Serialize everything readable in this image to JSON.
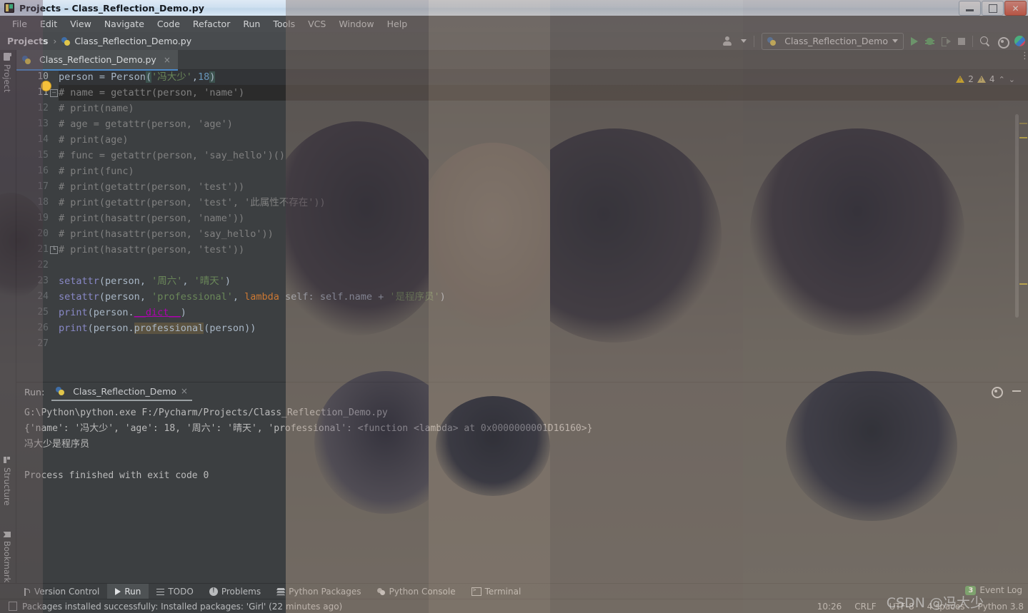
{
  "window": {
    "title": "Projects – Class_Reflection_Demo.py",
    "app_icon": "pycharm-logo-icon",
    "controls": [
      {
        "name": "minimize-button",
        "glyph": "minimize-icon"
      },
      {
        "name": "maximize-button",
        "glyph": "maximize-icon"
      },
      {
        "name": "close-button",
        "glyph": "close-icon",
        "color": "#d8432c"
      }
    ]
  },
  "menubar": {
    "items": [
      "File",
      "Edit",
      "View",
      "Navigate",
      "Code",
      "Refactor",
      "Run",
      "Tools",
      "VCS",
      "Window",
      "Help"
    ]
  },
  "navbar": {
    "crumbs": [
      "Projects",
      "Class_Reflection_Demo.py"
    ],
    "separator": "›",
    "file_icon": "python-file-icon",
    "account_icon": "account-icon",
    "run_config": {
      "name": "Class_Reflection_Demo",
      "icon": "python-file-icon",
      "dropdown_icon": "chevron-down-icon"
    },
    "actions": [
      {
        "name": "run-button",
        "icon": "run-triangle-icon"
      },
      {
        "name": "debug-button",
        "icon": "debug-bug-icon"
      },
      {
        "name": "run-with-coverage-button",
        "icon": "run-coverage-icon"
      },
      {
        "name": "stop-button",
        "icon": "stop-square-icon"
      },
      {
        "name": "search-everywhere-button",
        "icon": "search-icon"
      },
      {
        "name": "settings-button",
        "icon": "gear-icon"
      },
      {
        "name": "ide-logo",
        "icon": "intellij-logo-icon"
      }
    ]
  },
  "left_stripe": {
    "items": [
      {
        "label": "Project",
        "icon": "folder-icon"
      },
      {
        "label": "Structure",
        "icon": "structure-icon"
      },
      {
        "label": "Bookmarks",
        "icon": "bookmark-icon"
      }
    ]
  },
  "tabs": [
    {
      "label": "Class_Reflection_Demo.py",
      "icon": "python-file-icon",
      "close": "×",
      "active": true
    }
  ],
  "editor": {
    "first_line": 10,
    "kebab_glyph": "⋮",
    "inspections": {
      "warnings_major": "2",
      "warnings_minor": "4",
      "up": "⌃",
      "down": "⌄"
    },
    "lines": [
      {
        "n": 10,
        "state": "current",
        "tokens": [
          {
            "t": "person ",
            "c": "t-def"
          },
          {
            "t": "= ",
            "c": "t-def"
          },
          {
            "t": "Person",
            "c": "t-def"
          },
          {
            "t": "(",
            "c": "hl-brace t-def"
          },
          {
            "t": "'冯大少'",
            "c": "t-str"
          },
          {
            "t": ",",
            "c": "t-def"
          },
          {
            "t": "18",
            "c": "t-num"
          },
          {
            "t": ")",
            "c": "hl-brace t-def"
          }
        ]
      },
      {
        "n": 11,
        "state": "caret",
        "fold": true,
        "bulb": true,
        "tokens": [
          {
            "t": "# name = getattr(person, 'name')",
            "c": "t-cmt"
          }
        ]
      },
      {
        "n": 12,
        "tokens": [
          {
            "t": "# print(name)",
            "c": "t-cmt"
          }
        ]
      },
      {
        "n": 13,
        "tokens": [
          {
            "t": "# age = getattr(person, 'age')",
            "c": "t-cmt"
          }
        ]
      },
      {
        "n": 14,
        "tokens": [
          {
            "t": "# print(age)",
            "c": "t-cmt"
          }
        ]
      },
      {
        "n": 15,
        "tokens": [
          {
            "t": "# func = getattr(person, 'say_hello')()",
            "c": "t-cmt"
          }
        ]
      },
      {
        "n": 16,
        "tokens": [
          {
            "t": "# print(func)",
            "c": "t-cmt"
          }
        ]
      },
      {
        "n": 17,
        "tokens": [
          {
            "t": "# print(getattr(person, 'test'))",
            "c": "t-cmt"
          }
        ]
      },
      {
        "n": 18,
        "tokens": [
          {
            "t": "# print(getattr(person, 'test', '此属性不存在'))",
            "c": "t-cmt"
          }
        ]
      },
      {
        "n": 19,
        "tokens": [
          {
            "t": "# print(hasattr(person, 'name'))",
            "c": "t-cmt"
          }
        ]
      },
      {
        "n": 20,
        "tokens": [
          {
            "t": "# print(hasattr(person, 'say_hello'))",
            "c": "t-cmt"
          }
        ]
      },
      {
        "n": 21,
        "foldEnd": true,
        "tokens": [
          {
            "t": "# print(hasattr(person, 'test'))",
            "c": "t-cmt"
          }
        ]
      },
      {
        "n": 22,
        "tokens": []
      },
      {
        "n": 23,
        "tokens": [
          {
            "t": "setattr",
            "c": "t-builtin"
          },
          {
            "t": "(person",
            "c": "t-def"
          },
          {
            "t": ", ",
            "c": "t-def"
          },
          {
            "t": "'周六'",
            "c": "t-str"
          },
          {
            "t": ", ",
            "c": "t-def"
          },
          {
            "t": "'晴天'",
            "c": "t-str"
          },
          {
            "t": ")",
            "c": "t-def"
          }
        ]
      },
      {
        "n": 24,
        "tokens": [
          {
            "t": "setattr",
            "c": "t-builtin"
          },
          {
            "t": "(person",
            "c": "t-def"
          },
          {
            "t": ", ",
            "c": "t-def"
          },
          {
            "t": "'professional'",
            "c": "t-str"
          },
          {
            "t": ", ",
            "c": "t-def"
          },
          {
            "t": "lambda",
            "c": "t-kw"
          },
          {
            "t": " self: self.name + ",
            "c": "t-def"
          },
          {
            "t": "'是程序员'",
            "c": "t-str"
          },
          {
            "t": ")",
            "c": "t-def"
          }
        ]
      },
      {
        "n": 25,
        "tokens": [
          {
            "t": "print",
            "c": "t-builtin"
          },
          {
            "t": "(person.",
            "c": "t-def"
          },
          {
            "t": "__dict__",
            "c": "t-dunder"
          },
          {
            "t": ")",
            "c": "t-def"
          }
        ]
      },
      {
        "n": 26,
        "tokens": [
          {
            "t": "print",
            "c": "t-builtin"
          },
          {
            "t": "(person.",
            "c": "t-def"
          },
          {
            "t": "professional",
            "c": "hl-ident t-def"
          },
          {
            "t": "(person))",
            "c": "t-def"
          }
        ]
      },
      {
        "n": 27,
        "tokens": []
      }
    ]
  },
  "run_window": {
    "label": "Run:",
    "tab": {
      "label": "Class_Reflection_Demo",
      "icon": "python-file-icon",
      "close": "×"
    },
    "actions": [
      {
        "name": "console-settings-button",
        "icon": "gear-icon"
      },
      {
        "name": "hide-tool-window-button",
        "icon": "minimize-icon"
      }
    ],
    "console_lines": [
      "G:\\Python\\python.exe F:/Pycharm/Projects/Class_Reflection_Demo.py",
      "{'name': '冯大少', 'age': 18, '周六': '晴天', 'professional': <function <lambda> at 0x0000000001D16160>}",
      "冯大少是程序员",
      "",
      "Process finished with exit code 0"
    ]
  },
  "bottom_bar": {
    "items": [
      {
        "label": "Version Control",
        "icon": "version-control-icon",
        "active": false
      },
      {
        "label": "Run",
        "icon": "run-triangle-icon",
        "active": true
      },
      {
        "label": "TODO",
        "icon": "todo-list-icon",
        "active": false
      },
      {
        "label": "Problems",
        "icon": "problems-icon",
        "active": false
      },
      {
        "label": "Python Packages",
        "icon": "packages-icon",
        "active": false
      },
      {
        "label": "Python Console",
        "icon": "python-console-icon",
        "active": false
      },
      {
        "label": "Terminal",
        "icon": "terminal-icon",
        "active": false
      }
    ]
  },
  "status_bar": {
    "message": "Packages installed successfully: Installed packages: 'Girl' (22 minutes ago)",
    "message_icon": "notification-icon",
    "right_items": [
      "10:26",
      "CRLF",
      "UTF-8",
      "4 spaces",
      "Python 3.8"
    ],
    "event_log": {
      "label": "Event Log",
      "count": "3",
      "badge_color": "#4d9a51"
    }
  },
  "watermark": "CSDN @冯大少"
}
